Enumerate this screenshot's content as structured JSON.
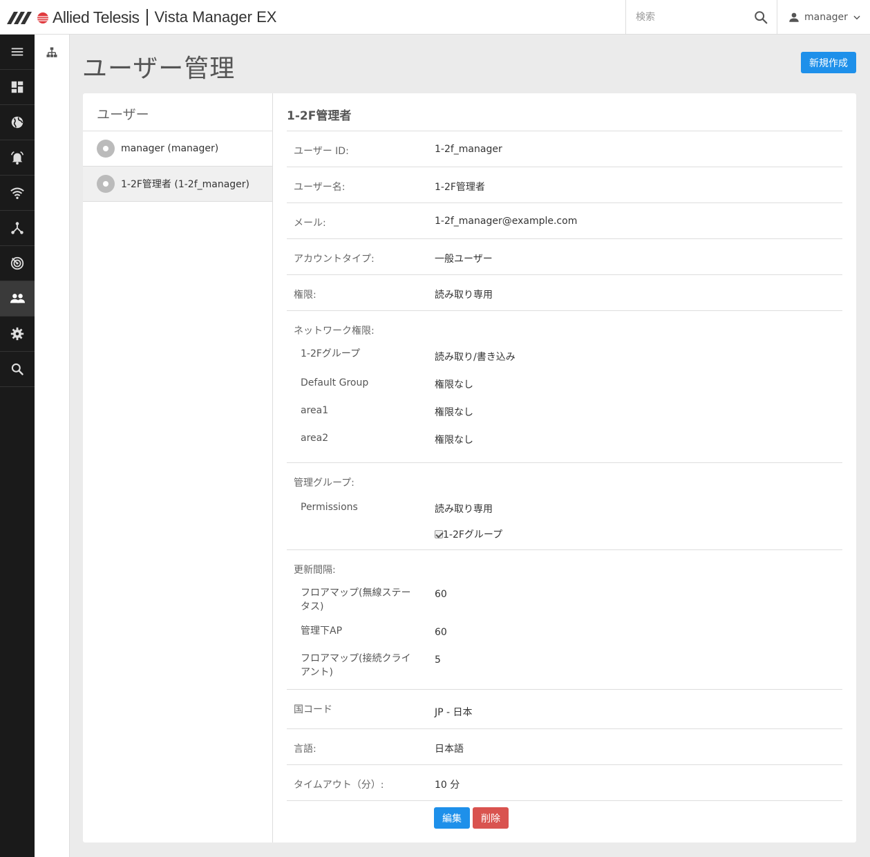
{
  "header": {
    "brand": "Allied Telesis",
    "product": "Vista Manager EX",
    "search_placeholder": "検索",
    "username": "manager"
  },
  "nav": {
    "icons": [
      "menu-icon",
      "dashboard-icon",
      "globe-icon",
      "alarm-icon",
      "wifi-icon",
      "network-icon",
      "radar-icon",
      "users-icon",
      "gear-icon",
      "search-icon"
    ],
    "active": "users-icon"
  },
  "page": {
    "title": "ユーザー管理",
    "new_button": "新規作成"
  },
  "user_list": {
    "heading": "ユーザー",
    "items": [
      {
        "label": "manager (manager)"
      },
      {
        "label": "1-2F管理者 (1-2f_manager)"
      }
    ],
    "selected_index": 1
  },
  "detail": {
    "title": "1-2F管理者",
    "user_id_label": "ユーザー ID:",
    "user_id": "1-2f_manager",
    "user_name_label": "ユーザー名:",
    "user_name": "1-2F管理者",
    "mail_label": "メール:",
    "mail": "1-2f_manager@example.com",
    "account_type_label": "アカウントタイプ:",
    "account_type": "一般ユーザー",
    "permission_label": "権限:",
    "permission": "読み取り専用",
    "network_perm_label": "ネットワーク権限:",
    "network_perms": [
      {
        "name": "1-2Fグループ",
        "value": "読み取り/書き込み"
      },
      {
        "name": "Default Group",
        "value": "権限なし"
      },
      {
        "name": "area1",
        "value": "権限なし"
      },
      {
        "name": "area2",
        "value": "権限なし"
      }
    ],
    "admin_group_label": "管理グループ:",
    "admin_group_perm_name": "Permissions",
    "admin_group_perm_value": "読み取り専用",
    "admin_group_checked": "1-2Fグループ",
    "refresh_label": "更新間隔:",
    "refresh": [
      {
        "name": "フロアマップ(無線ステータス)",
        "value": "60"
      },
      {
        "name": "管理下AP",
        "value": "60"
      },
      {
        "name": "フロアマップ(接続クライアント)",
        "value": "5"
      }
    ],
    "country_label": "国コード",
    "country": "JP - 日本",
    "language_label": "言語:",
    "language": "日本語",
    "timeout_label": "タイムアウト（分）:",
    "timeout": "10 分",
    "edit_button": "編集",
    "delete_button": "削除"
  }
}
